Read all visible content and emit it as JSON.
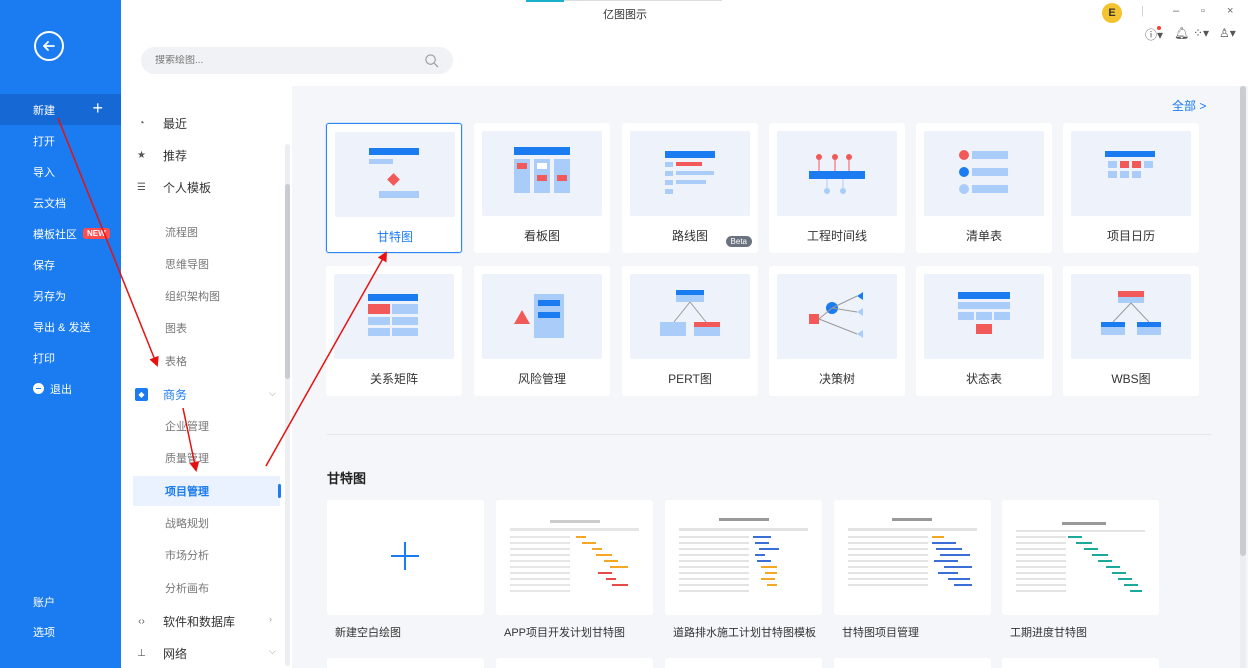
{
  "window": {
    "title": "亿图图示",
    "controls": [
      "–",
      "▫",
      "×"
    ],
    "avatar_letter": "E"
  },
  "search": {
    "placeholder": "搜索绘图..."
  },
  "sidebar": {
    "items": [
      {
        "label": "新建",
        "plus": "+"
      },
      {
        "label": "打开"
      },
      {
        "label": "导入"
      },
      {
        "label": "云文档"
      },
      {
        "label": "模板社区",
        "badge": "NEW"
      },
      {
        "label": "保存"
      },
      {
        "label": "另存为"
      },
      {
        "label": "导出 & 发送"
      },
      {
        "label": "打印"
      },
      {
        "label": "退出"
      }
    ],
    "bottom": [
      {
        "label": "账户"
      },
      {
        "label": "选项"
      }
    ]
  },
  "categories": {
    "top": [
      {
        "label": "最近"
      },
      {
        "label": "推荐"
      },
      {
        "label": "个人模板"
      }
    ],
    "general": [
      {
        "label": "流程图"
      },
      {
        "label": "思维导图"
      },
      {
        "label": "组织架构图"
      },
      {
        "label": "图表"
      },
      {
        "label": "表格"
      }
    ],
    "business": {
      "label": "商务",
      "subs": [
        {
          "label": "企业管理"
        },
        {
          "label": "质量管理"
        },
        {
          "label": "项目管理"
        },
        {
          "label": "战略规划"
        },
        {
          "label": "市场分析"
        },
        {
          "label": "分析画布"
        }
      ]
    },
    "more": [
      {
        "label": "软件和数据库"
      },
      {
        "label": "网络"
      }
    ]
  },
  "content": {
    "all_link": "全部 >",
    "types": [
      {
        "label": "甘特图"
      },
      {
        "label": "看板图"
      },
      {
        "label": "路线图",
        "badge": "Beta"
      },
      {
        "label": "工程时间线"
      },
      {
        "label": "清单表"
      },
      {
        "label": "项目日历"
      },
      {
        "label": "关系矩阵"
      },
      {
        "label": "风险管理"
      },
      {
        "label": "PERT图"
      },
      {
        "label": "决策树"
      },
      {
        "label": "状态表"
      },
      {
        "label": "WBS图"
      }
    ],
    "section_title": "甘特图",
    "templates": [
      {
        "label": "新建空白绘图"
      },
      {
        "label": "APP项目开发计划甘特图"
      },
      {
        "label": "道路排水施工计划甘特图模板"
      },
      {
        "label": "甘特图项目管理"
      },
      {
        "label": "工期进度甘特图"
      }
    ]
  },
  "colors": {
    "brand": "#1b7bf0",
    "accent_red": "#ff4d4f",
    "annotation": "#e81010"
  }
}
